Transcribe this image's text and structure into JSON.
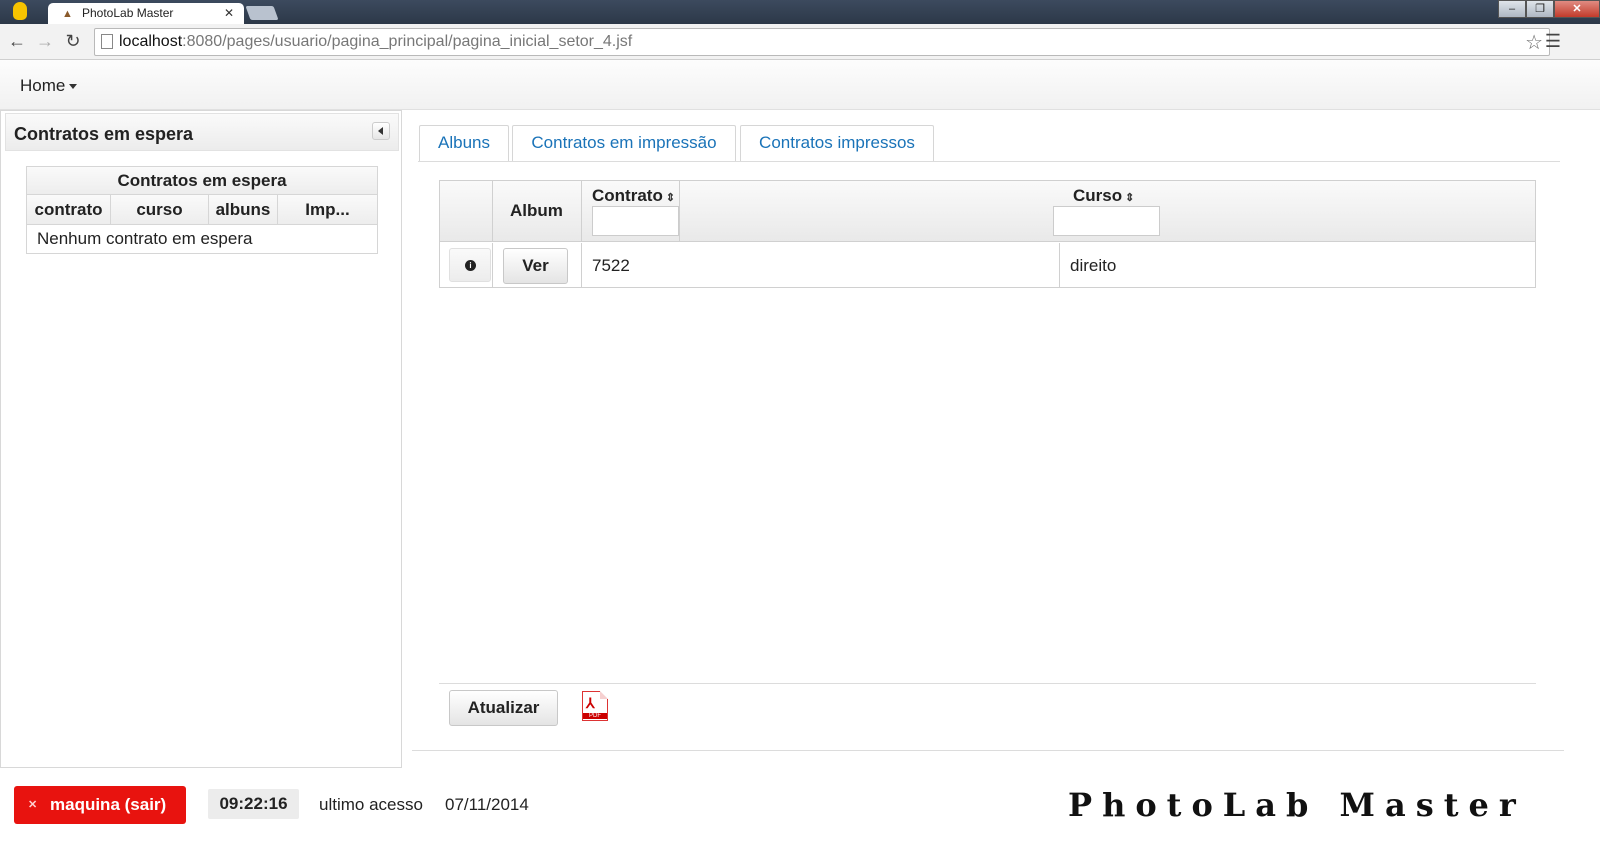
{
  "browser": {
    "tab_title": "PhotoLab Master",
    "url_host": "localhost",
    "url_rest": ":8080/pages/usuario/pagina_principal/pagina_inicial_setor_4.jsf"
  },
  "menubar": {
    "home_label": "Home"
  },
  "left_panel": {
    "title": "Contratos em espera",
    "table": {
      "caption": "Contratos em espera",
      "columns": [
        "contrato",
        "curso",
        "albuns",
        "Imp..."
      ],
      "empty_message": "Nenhum contrato em espera"
    }
  },
  "tabs": [
    {
      "label": "Albuns"
    },
    {
      "label": "Contratos em impressão"
    },
    {
      "label": "Contratos impressos"
    }
  ],
  "grid": {
    "headers": {
      "album": "Album",
      "contrato": "Contrato",
      "curso": "Curso"
    },
    "rows": [
      {
        "action_label": "Ver",
        "contrato": "7522",
        "curso": "direito"
      }
    ]
  },
  "actions": {
    "atualizar_label": "Atualizar",
    "pdf_icon_label": "PDF"
  },
  "footer": {
    "logout_label": "maquina (sair)",
    "clock": "09:22:16",
    "last_access_label": "ultimo acesso",
    "last_access_date": "07/11/2014",
    "brand": "PhotoLab Master"
  },
  "colors": {
    "accent_link": "#1a73b8",
    "logout_red": "#e8130f"
  },
  "icons": [
    "chrome-logo-icon",
    "back-icon",
    "forward-icon",
    "reload-icon",
    "star-icon",
    "menu-icon",
    "info-icon",
    "pdf-icon",
    "close-icon",
    "sort-icon"
  ]
}
